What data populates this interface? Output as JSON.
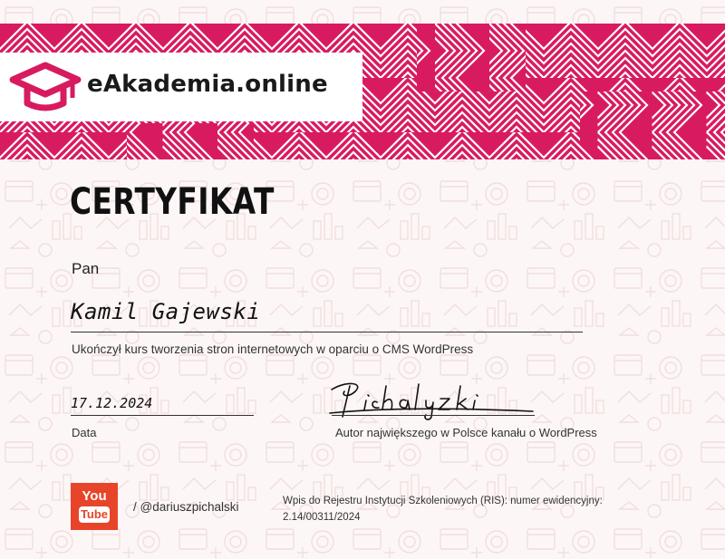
{
  "brand": {
    "logo_text": "eAkademia.online",
    "primary_color": "#d81b60",
    "logo_icon": "graduation-cap-icon"
  },
  "certificate": {
    "title": "CERTYFIKAT",
    "salutation": "Pan",
    "recipient_name": "Kamil Gajewski",
    "course_text": "Ukończył kurs tworzenia stron internetowych w oparciu o CMS WordPress",
    "date_value": "17.12.2024",
    "date_label": "Data",
    "author_label": "Autor największego w Polsce kanału o WordPress"
  },
  "footer": {
    "youtube_icon": "youtube-icon",
    "youtube_you": "You",
    "youtube_tube": "Tube",
    "youtube_handle": "/ @dariuszpichalski",
    "ris_text": "Wpis do Rejestru Instytucji Szkoleniowych (RIS): numer ewidencyjny: 2.14/00311/2024"
  }
}
